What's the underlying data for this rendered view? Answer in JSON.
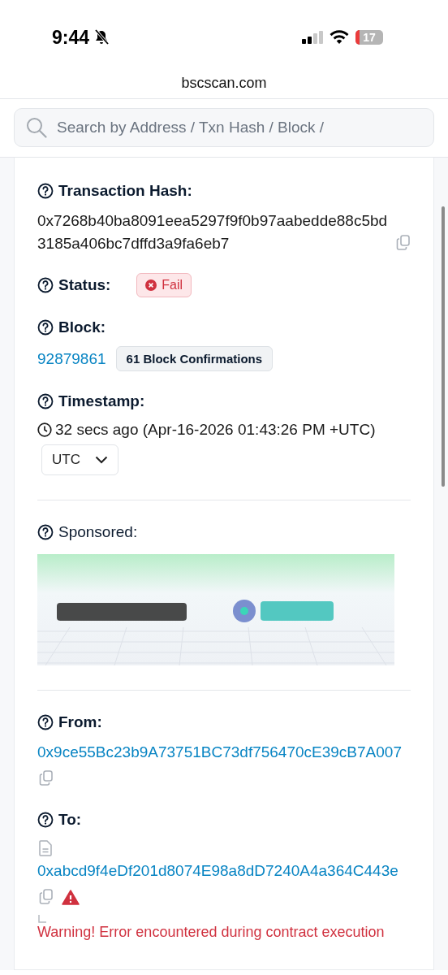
{
  "status_bar": {
    "time": "9:44",
    "silent": true,
    "battery": "17"
  },
  "address_bar": {
    "url": "bscscan.com"
  },
  "search": {
    "placeholder": "Search by Address / Txn Hash / Block /"
  },
  "fields": [
    {
      "kind": "hash",
      "label": "Transaction Hash:",
      "value": "0x7268b40ba8091eea5297f9f0b97aabedde88c5bd3185a406bc7dffd3a9fa6eb7",
      "divider": false
    },
    {
      "kind": "status",
      "label": "Status:",
      "value": "Fail",
      "divider": false
    },
    {
      "kind": "block",
      "label": "Block:",
      "value": "92879861",
      "badge": "61 Block Confirmations",
      "divider": false
    },
    {
      "kind": "timestamp",
      "label": "Timestamp:",
      "value": "32 secs ago (Apr-16-2026 01:43:26 PM +UTC)",
      "timezone": "UTC",
      "divider": true
    },
    {
      "kind": "sponsored",
      "label": "Sponsored:",
      "divider": true
    },
    {
      "kind": "from",
      "label": "From:",
      "value": "0x9ce55Bc23b9A73751BC73df756470cE39cB7A007",
      "divider": false
    },
    {
      "kind": "to",
      "label": "To:",
      "value": "0xabcd9f4eDf201d8074E98a8dD7240A4a364C443e",
      "contract": true,
      "failed": true,
      "warning": "Warning! Error encountered during contract execution",
      "divider": false
    }
  ]
}
